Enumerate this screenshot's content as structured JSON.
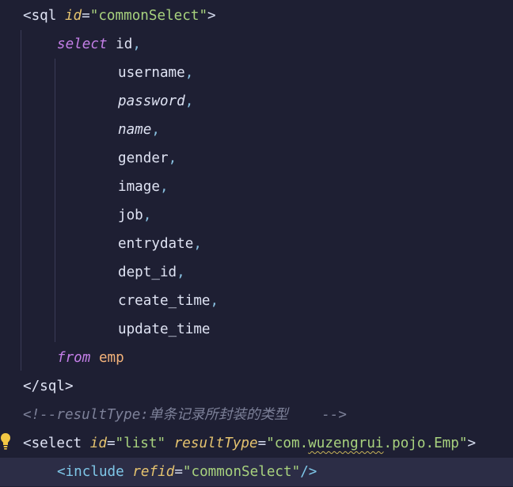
{
  "code": {
    "sql_open": {
      "lt": "<",
      "tag": "sql",
      "attr": "id",
      "eq": "=",
      "value": "\"commonSelect\"",
      "gt": ">"
    },
    "select_kw": "select",
    "columns": {
      "id": "id",
      "username": "username",
      "password": "password",
      "name": "name",
      "gender": "gender",
      "image": "image",
      "job": "job",
      "entrydate": "entrydate",
      "dept_id": "dept_id",
      "create_time": "create_time",
      "update_time": "update_time"
    },
    "comma": ",",
    "from_kw": "from",
    "table": "emp",
    "sql_close": "</sql>",
    "comment": "<!--resultType:单条记录所封装的类型    -->",
    "select_tag": {
      "lt": "<",
      "tag": "select",
      "attr1": "id",
      "val1": "\"list\"",
      "attr2": "resultType",
      "val2_q1": "\"com.",
      "val2_pkg": "wuzengrui",
      "val2_rest": ".pojo.Emp\"",
      "gt": ">",
      "eq": "="
    },
    "include_tag": {
      "lt": "<",
      "tag": "include",
      "attr": "refid",
      "eq": "=",
      "value": "\"commonSelect\"",
      "close": "/>"
    }
  },
  "colors": {
    "background": "#1e1f33",
    "current_line": "#2c2d46",
    "keyword": "#c47fe8",
    "attribute": "#e5c36f",
    "string": "#a8d27e",
    "table": "#f3b27a",
    "comment": "#7d8199"
  },
  "icons": {
    "gutter": "lightbulb-icon"
  }
}
